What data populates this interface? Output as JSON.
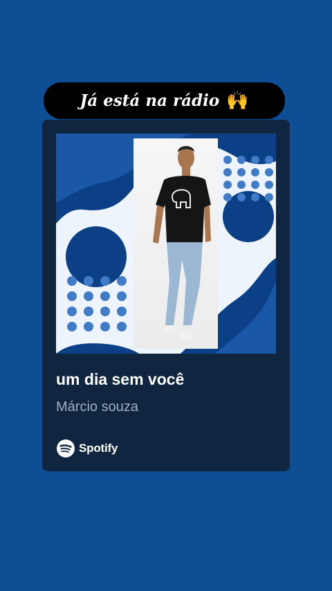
{
  "sticker": {
    "text": "Já está na rádio",
    "emoji": "🙌"
  },
  "track": {
    "title": "um dia sem você",
    "artist": "Márcio souza"
  },
  "brand": {
    "name": "Spotify",
    "logo_icon": "spotify-logo-icon"
  },
  "colors": {
    "background": "#0d4e94",
    "card": "#0f2540",
    "sticker": "#000000",
    "cover_dark_blue": "#0b3f86",
    "cover_dot_blue": "#3f7bc6"
  }
}
